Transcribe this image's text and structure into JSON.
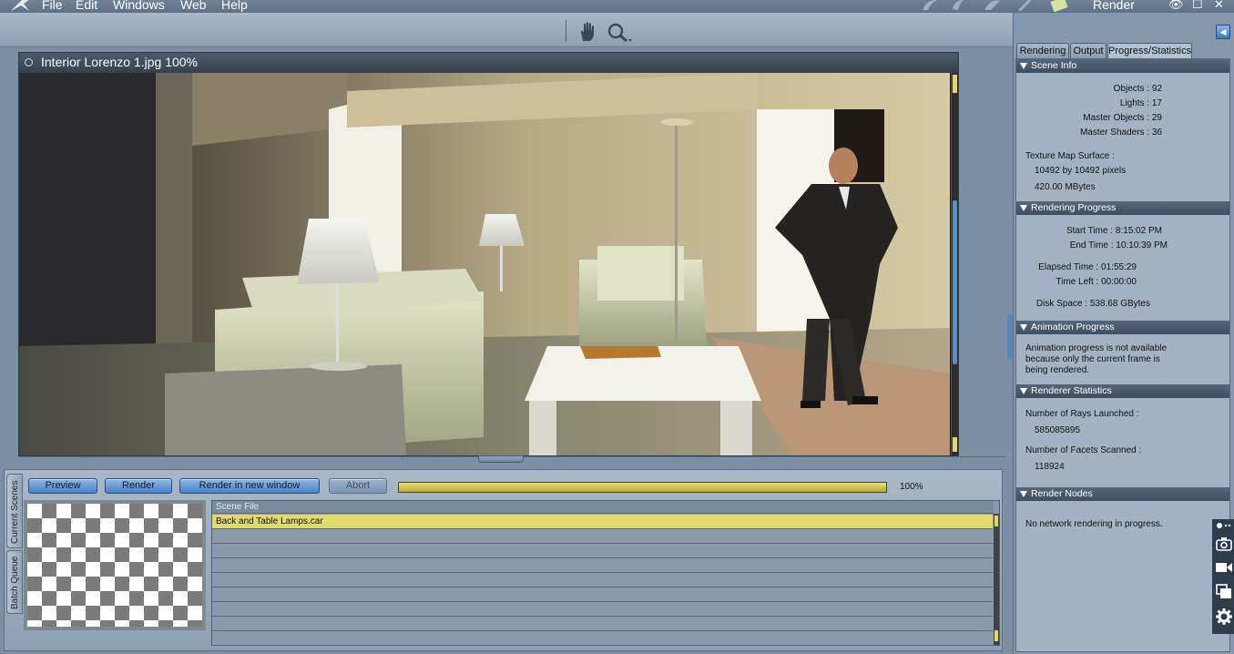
{
  "menu": {
    "items": [
      "File",
      "Edit",
      "Windows",
      "Web",
      "Help"
    ],
    "room_title": "Render"
  },
  "window_controls": {
    "eye": "👁",
    "maximize": "☐",
    "close": "✕"
  },
  "render_window": {
    "title": "Interior Lorenzo 1.jpg 100%"
  },
  "render_controls": {
    "preview_label": "Preview",
    "render_label": "Render",
    "render_new_label": "Render in new window",
    "abort_label": "Abort",
    "progress": 100,
    "progress_label": "100%"
  },
  "side_tabs": {
    "current_scenes": "Current Scenes",
    "batch_queue": "Batch Queue"
  },
  "scene_table": {
    "header": "Scene File",
    "rows": [
      "Back and Table Lamps.car",
      "",
      "",
      "",
      "",
      "",
      "",
      "",
      ""
    ]
  },
  "right_panel": {
    "tabs": [
      "Rendering",
      "Output",
      "Progress/Statistics"
    ],
    "scene_info": {
      "header": "Scene Info",
      "objects": "Objects : 92",
      "lights": "Lights : 17",
      "master_objects": "Master Objects : 29",
      "master_shaders": "Master Shaders : 36",
      "texture_label": "Texture Map Surface :",
      "texture_size": "10492 by 10492 pixels",
      "texture_mem": "420.00 MBytes"
    },
    "rendering_progress": {
      "header": "Rendering Progress",
      "start": "Start Time : 8:15:02 PM",
      "end": "End Time : 10:10:39 PM",
      "elapsed": "Elapsed Time : 01:55:29",
      "left": "Time Left : 00:00:00",
      "disk": "Disk Space : 538.68 GBytes"
    },
    "animation_progress": {
      "header": "Animation Progress",
      "line1": "Animation progress is not available",
      "line2": "because only the current frame is",
      "line3": "being rendered."
    },
    "renderer_statistics": {
      "header": "Renderer Statistics",
      "rays_label": "Number of Rays Launched :",
      "rays_value": "585085895",
      "facets_label": "Number of Facets Scanned :",
      "facets_value": "118924"
    },
    "render_nodes": {
      "header": "Render Nodes",
      "text": "No network rendering in progress."
    }
  },
  "icons": [
    "app-logo-icon",
    "hand-tool-icon",
    "zoom-tool-icon",
    "camera-icon",
    "video-icon",
    "layers-icon",
    "gear-icon"
  ]
}
